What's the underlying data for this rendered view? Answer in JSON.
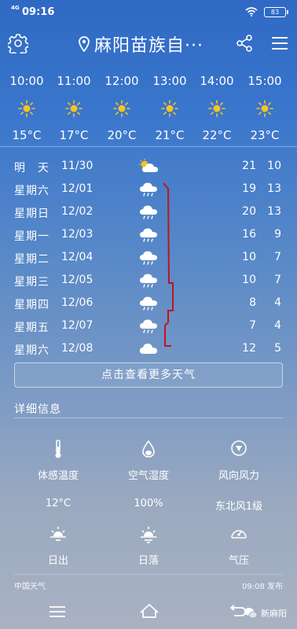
{
  "status_bar": {
    "time": "09:16",
    "network": "4G",
    "battery": "83"
  },
  "header": {
    "city": "麻阳苗族自···",
    "icons": [
      "settings-icon",
      "location-pin-icon",
      "share-icon",
      "menu-icon"
    ]
  },
  "hourly": [
    {
      "time": "10:00",
      "icon": "sun-icon",
      "temp": "15°C"
    },
    {
      "time": "11:00",
      "icon": "sun-icon",
      "temp": "17°C"
    },
    {
      "time": "12:00",
      "icon": "sun-icon",
      "temp": "20°C"
    },
    {
      "time": "13:00",
      "icon": "sun-icon",
      "temp": "21°C"
    },
    {
      "time": "14:00",
      "icon": "sun-icon",
      "temp": "22°C"
    },
    {
      "time": "15:00",
      "icon": "sun-icon",
      "temp": "23°C"
    }
  ],
  "daily": [
    {
      "name": "明　天",
      "date": "11/30",
      "icon": "partly-cloudy-icon",
      "high": "21",
      "low": "10"
    },
    {
      "name": "星期六",
      "date": "12/01",
      "icon": "rain-cloud-icon",
      "high": "19",
      "low": "13"
    },
    {
      "name": "星期日",
      "date": "12/02",
      "icon": "rain-cloud-icon",
      "high": "20",
      "low": "13"
    },
    {
      "name": "星期一",
      "date": "12/03",
      "icon": "rain-cloud-icon",
      "high": "16",
      "low": "9"
    },
    {
      "name": "星期二",
      "date": "12/04",
      "icon": "rain-cloud-icon",
      "high": "10",
      "low": "7"
    },
    {
      "name": "星期三",
      "date": "12/05",
      "icon": "rain-cloud-icon",
      "high": "10",
      "low": "7"
    },
    {
      "name": "星期四",
      "date": "12/06",
      "icon": "rain-cloud-icon",
      "high": "8",
      "low": "4"
    },
    {
      "name": "星期五",
      "date": "12/07",
      "icon": "rain-cloud-icon",
      "high": "7",
      "low": "4"
    },
    {
      "name": "星期六",
      "date": "12/08",
      "icon": "cloud-icon",
      "high": "12",
      "low": "5"
    }
  ],
  "more_button": "点击查看更多天气",
  "details": {
    "title": "详细信息",
    "items": [
      {
        "icon": "thermometer-icon",
        "label": "体感温度",
        "value": "12°C"
      },
      {
        "icon": "humidity-drop-icon",
        "label": "空气湿度",
        "value": "100%"
      },
      {
        "icon": "wind-direction-icon",
        "label": "风向风力",
        "value": "东北风1级"
      },
      {
        "icon": "sunrise-icon",
        "label": "日出",
        "value": ""
      },
      {
        "icon": "sunset-icon",
        "label": "日落",
        "value": ""
      },
      {
        "icon": "pressure-gauge-icon",
        "label": "气压",
        "value": ""
      }
    ]
  },
  "footer": {
    "source": "中国天气",
    "published": "09:08 发布"
  },
  "watermark": "新麻阳",
  "colors": {
    "annotation_line": "#c0141e",
    "sun": "#f6c226"
  }
}
